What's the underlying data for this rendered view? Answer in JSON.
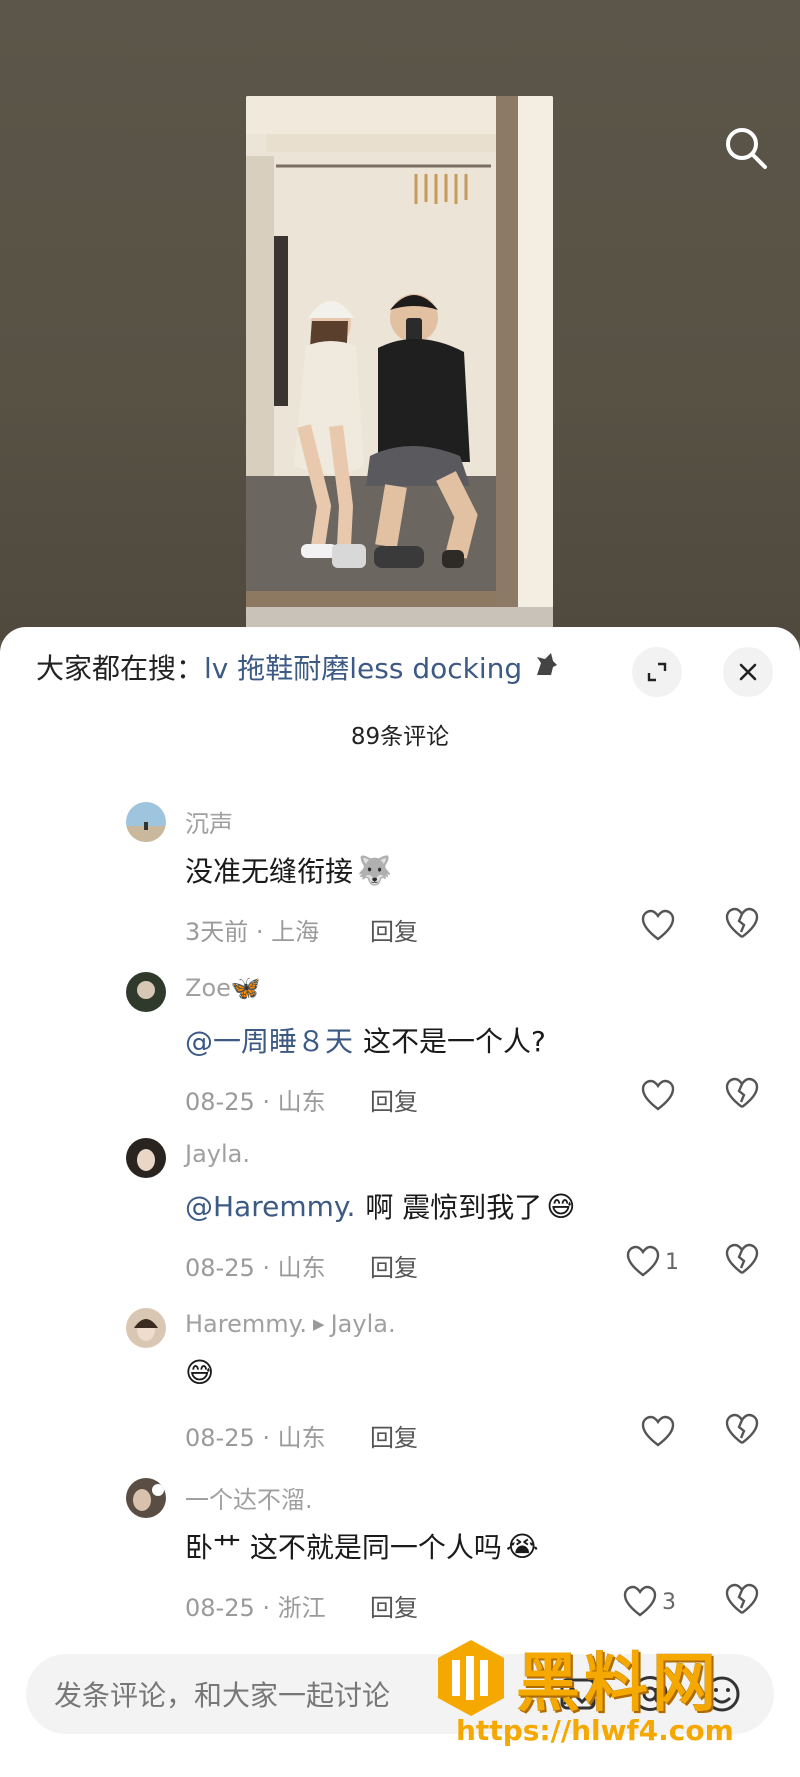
{
  "video": {
    "search_icon": "search-icon"
  },
  "panel": {
    "hot_search_prefix": "大家都在搜：",
    "hot_search_query": "lv 拖鞋耐磨less docking",
    "expand_icon": "expand-icon",
    "close_icon": "close-icon",
    "comment_count": "89条评论"
  },
  "comments": [
    {
      "username": "沉声",
      "reply_to": "",
      "mention": "",
      "text": "没准无缝衔接",
      "emoji": "🐺",
      "time": "3天前",
      "location": "上海",
      "reply_label": "回复",
      "likes": ""
    },
    {
      "username": "Zoe🦋",
      "reply_to": "",
      "mention": "@一周睡８天",
      "text": "这不是一个人?",
      "emoji": "",
      "time": "08-25",
      "location": "山东",
      "reply_label": "回复",
      "likes": ""
    },
    {
      "username": "Jayla.",
      "reply_to": "",
      "mention": "@Haremmy.",
      "text": "啊 震惊到我了",
      "emoji": "😅",
      "time": "08-25",
      "location": "山东",
      "reply_label": "回复",
      "likes": "1"
    },
    {
      "username": "Haremmy.",
      "reply_to": "Jayla.",
      "mention": "",
      "text": "",
      "emoji": "😅",
      "time": "08-25",
      "location": "山东",
      "reply_label": "回复",
      "likes": ""
    },
    {
      "username": "一个达不溜.",
      "reply_to": "",
      "mention": "",
      "text": "卧艹 这不就是同一个人吗",
      "emoji": "😭",
      "time": "08-25",
      "location": "浙江",
      "reply_label": "回复",
      "likes": "3"
    }
  ],
  "input": {
    "placeholder": "发条评论，和大家一起讨论",
    "icons": [
      "image-icon",
      "at-icon",
      "emoji-icon"
    ]
  },
  "watermark": {
    "text": "黑料网",
    "url": "https://hlwf4.com"
  },
  "colors": {
    "accent_link": "#3d5a85",
    "watermark": "#f5a800",
    "panel_bg": "#ffffff",
    "video_bg": "#5a5448"
  }
}
